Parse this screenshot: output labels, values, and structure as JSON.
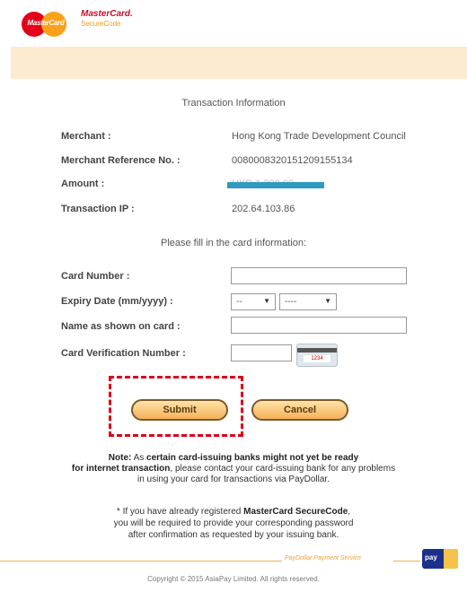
{
  "header": {
    "mastercard_logo_text": "MasterCard",
    "securecode_line1": "MasterCard.",
    "securecode_line2": "SecureCode"
  },
  "title": "Transaction Information",
  "info": {
    "merchant_label": "Merchant :",
    "merchant_value": "Hong Kong Trade Development Council",
    "ref_label": "Merchant Reference No. :",
    "ref_value": "008000832015120915513​4",
    "amount_label": "Amount :",
    "amount_value": "HKD 1,200.00",
    "ip_label": "Transaction IP :",
    "ip_value": "202.64.103.86"
  },
  "subtitle": "Please fill in the card information:",
  "form": {
    "card_number_label": "Card Number :",
    "card_number_value": "",
    "expiry_label": "Expiry Date (mm/yyyy) :",
    "month_value": "--",
    "year_value": "----",
    "name_label": "Name as shown on card :",
    "name_value": "",
    "cvv_label": "Card Verification Number :",
    "cvv_value": "",
    "cvv_card_text": "1234"
  },
  "buttons": {
    "submit": "Submit",
    "cancel": "Cancel"
  },
  "note": {
    "line1_prefix": "Note:",
    "line1_mid": "As",
    "line1_bold": "certain card-issuing banks might not yet be ready",
    "line2_bold": "for internet transaction",
    "line2_rest": ", please contact your card-issuing bank for any problems",
    "line3": "in using your card for transactions via PayDollar."
  },
  "securecode_note": {
    "line1_prefix": "* If you have already registered",
    "line1_bold": "MasterCard SecureCode",
    "line2": "you will be required to provide your corresponding password",
    "line3": "after confirmation as requested by your issuing bank."
  },
  "footer": {
    "brand": "PayDollar Payment Service",
    "icon_text": "pay",
    "copyright": "Copyright © 2015 AsiaPay Limited. All rights reserved."
  },
  "colors": {
    "banner": "#fcebd1",
    "highlight": "#d9001b",
    "redaction": "#2f9bbf"
  }
}
